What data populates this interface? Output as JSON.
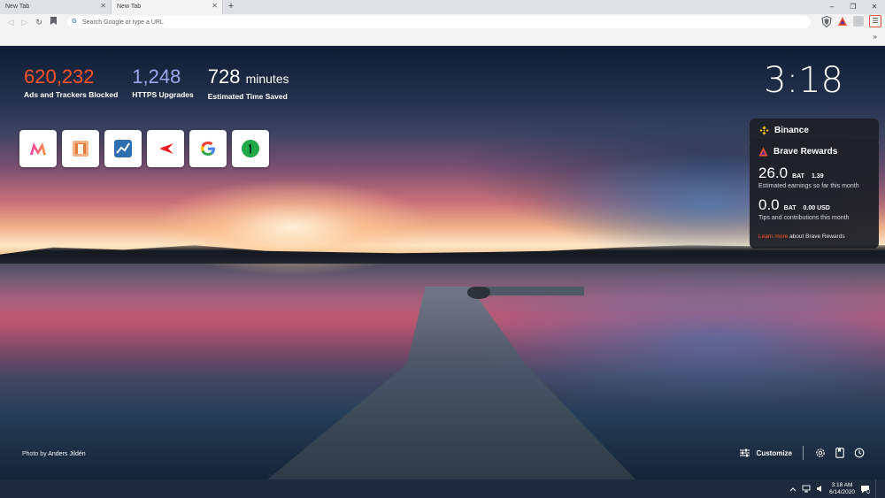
{
  "tabs": [
    {
      "title": "New Tab",
      "close": "✕"
    },
    {
      "title": "New Tab",
      "close": "✕"
    }
  ],
  "new_tab_label": "+",
  "window_controls": {
    "minimize": "–",
    "restore": "❐",
    "close": "✕"
  },
  "toolbar": {
    "back": "◁",
    "forward": "▷",
    "reload": "↻",
    "omnibox_placeholder": "Search Google or type a URL",
    "menu": "☰"
  },
  "bookmarks": {
    "overflow": "»"
  },
  "stats": {
    "ads_blocked": {
      "value": "620,232",
      "label": "Ads and Trackers Blocked"
    },
    "https_upgrades": {
      "value": "1,248",
      "label": "HTTPS Upgrades"
    },
    "time_saved": {
      "value": "728",
      "unit": "minutes",
      "label": "Estimated Time Saved"
    }
  },
  "clock": "3:18",
  "top_sites": [
    {
      "icon": "myntra-icon"
    },
    {
      "icon": "store-icon"
    },
    {
      "icon": "chart-app-icon"
    },
    {
      "icon": "kotak-icon"
    },
    {
      "icon": "google-icon"
    },
    {
      "icon": "one-icon"
    }
  ],
  "binance": {
    "title": "Binance"
  },
  "rewards": {
    "title": "Brave Rewards",
    "earnings_value": "26.0",
    "earnings_unit": "BAT",
    "earnings_usd": "1.39",
    "earnings_sub": "Estimated earnings so far this month",
    "tips_value": "0.0",
    "tips_unit": "BAT",
    "tips_usd": "0.00 USD",
    "tips_sub": "Tips and contributions this month",
    "learn_link": "Learn more",
    "learn_rest": "about Brave Rewards"
  },
  "credit": {
    "prefix": "Photo by",
    "name": "Anders Jildén"
  },
  "customize": "Customize",
  "taskbar": {
    "time": "3:18 AM",
    "date": "6/14/2020"
  },
  "colors": {
    "brave_orange": "#fb542b",
    "https_purple": "#a0a5eb",
    "binance_yellow": "#f0b90b"
  }
}
